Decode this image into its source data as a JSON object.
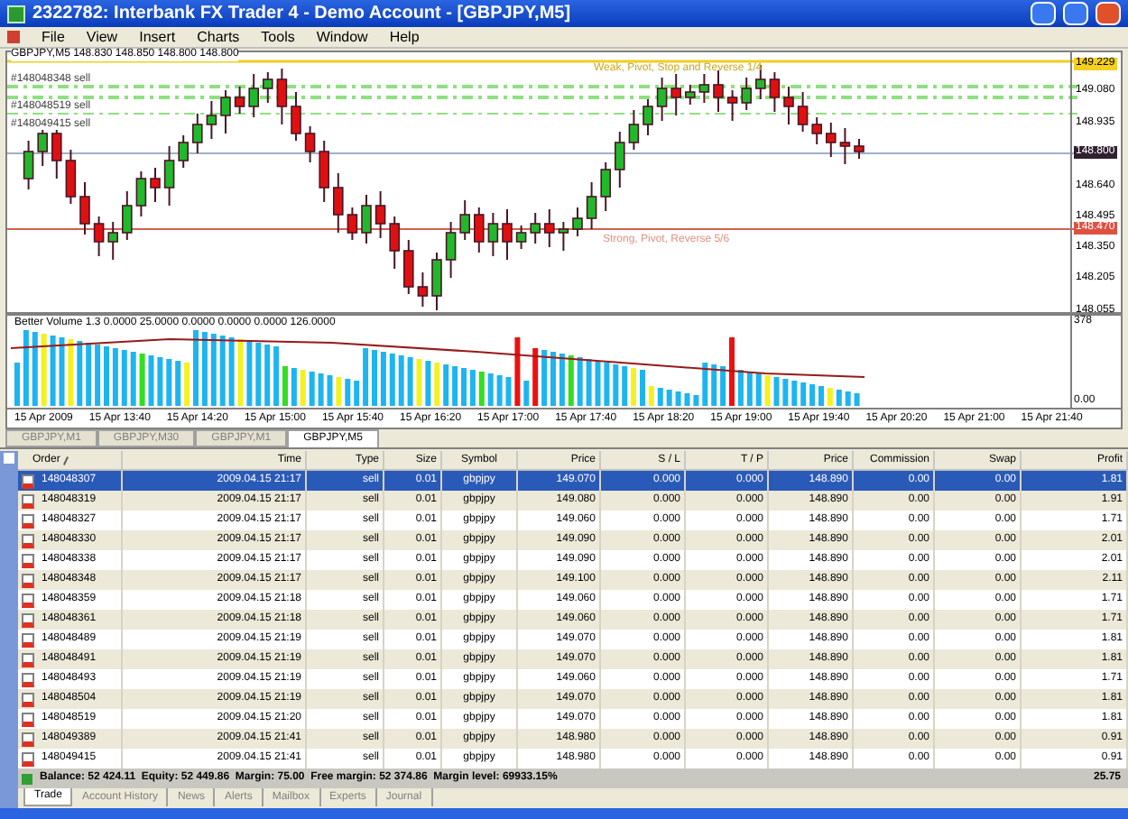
{
  "window": {
    "title": "2322782: Interbank FX Trader 4 - Demo Account - [GBPJPY,M5]"
  },
  "menu": [
    "File",
    "View",
    "Insert",
    "Charts",
    "Tools",
    "Window",
    "Help"
  ],
  "chart": {
    "header": "GBPJPY,M5  148.830 148.850 148.800 148.800",
    "order_labels": [
      "#148048348 sell",
      "#148048519 sell",
      "#148049415 sell"
    ],
    "level_labels": [
      {
        "text": "Weak, Pivot, Stop and Reverse 1/4",
        "kind": "weak"
      },
      {
        "text": "Strong, Pivot, Reverse 5/6",
        "kind": "strong"
      }
    ],
    "price_axis": [
      {
        "text": "149.229",
        "kind": "level"
      },
      {
        "text": "149.080",
        "kind": "plain"
      },
      {
        "text": "148.935",
        "kind": "plain"
      },
      {
        "text": "148.800",
        "kind": "bid"
      },
      {
        "text": "148.640",
        "kind": "plain"
      },
      {
        "text": "148.495",
        "kind": "plain"
      },
      {
        "text": "148.470",
        "kind": "pivot"
      },
      {
        "text": "148.350",
        "kind": "plain"
      },
      {
        "text": "148.205",
        "kind": "plain"
      },
      {
        "text": "148.055",
        "kind": "plain"
      }
    ],
    "volume": {
      "header": "Better Volume 1.3 0.0000 25.0000 0.0000 0.0000 0.0000 126.0000",
      "axis": [
        "378",
        "0.00"
      ]
    },
    "time_axis": [
      "15 Apr 2009",
      "15 Apr 13:40",
      "15 Apr 14:20",
      "15 Apr 15:00",
      "15 Apr 15:40",
      "15 Apr 16:20",
      "15 Apr 17:00",
      "15 Apr 17:40",
      "15 Apr 18:20",
      "15 Apr 19:00",
      "15 Apr 19:40",
      "15 Apr 20:20",
      "15 Apr 21:00",
      "15 Apr 21:40"
    ],
    "tabs": [
      {
        "label": "GBPJPY,M1",
        "selected": false
      },
      {
        "label": "GBPJPY,M30",
        "selected": false
      },
      {
        "label": "GBPJPY,M1",
        "selected": false
      },
      {
        "label": "GBPJPY,M5",
        "selected": true
      }
    ]
  },
  "terminal": {
    "columns": [
      "Order",
      "Time",
      "Type",
      "Size",
      "Symbol",
      "Price",
      "S / L",
      "T / P",
      "Price",
      "Commission",
      "Swap",
      "Profit"
    ],
    "rows": [
      {
        "cells": [
          "148048307",
          "2009.04.15 21:17",
          "sell",
          "0.01",
          "gbpjpy",
          "149.070",
          "0.000",
          "0.000",
          "148.890",
          "0.00",
          "0.00",
          "1.81"
        ],
        "selected": true
      },
      {
        "cells": [
          "148048319",
          "2009.04.15 21:17",
          "sell",
          "0.01",
          "gbpjpy",
          "149.080",
          "0.000",
          "0.000",
          "148.890",
          "0.00",
          "0.00",
          "1.91"
        ],
        "selected": false
      },
      {
        "cells": [
          "148048327",
          "2009.04.15 21:17",
          "sell",
          "0.01",
          "gbpjpy",
          "149.060",
          "0.000",
          "0.000",
          "148.890",
          "0.00",
          "0.00",
          "1.71"
        ],
        "selected": false
      },
      {
        "cells": [
          "148048330",
          "2009.04.15 21:17",
          "sell",
          "0.01",
          "gbpjpy",
          "149.090",
          "0.000",
          "0.000",
          "148.890",
          "0.00",
          "0.00",
          "2.01"
        ],
        "selected": false
      },
      {
        "cells": [
          "148048338",
          "2009.04.15 21:17",
          "sell",
          "0.01",
          "gbpjpy",
          "149.090",
          "0.000",
          "0.000",
          "148.890",
          "0.00",
          "0.00",
          "2.01"
        ],
        "selected": false
      },
      {
        "cells": [
          "148048348",
          "2009.04.15 21:17",
          "sell",
          "0.01",
          "gbpjpy",
          "149.100",
          "0.000",
          "0.000",
          "148.890",
          "0.00",
          "0.00",
          "2.11"
        ],
        "selected": false
      },
      {
        "cells": [
          "148048359",
          "2009.04.15 21:18",
          "sell",
          "0.01",
          "gbpjpy",
          "149.060",
          "0.000",
          "0.000",
          "148.890",
          "0.00",
          "0.00",
          "1.71"
        ],
        "selected": false
      },
      {
        "cells": [
          "148048361",
          "2009.04.15 21:18",
          "sell",
          "0.01",
          "gbpjpy",
          "149.060",
          "0.000",
          "0.000",
          "148.890",
          "0.00",
          "0.00",
          "1.71"
        ],
        "selected": false
      },
      {
        "cells": [
          "148048489",
          "2009.04.15 21:19",
          "sell",
          "0.01",
          "gbpjpy",
          "149.070",
          "0.000",
          "0.000",
          "148.890",
          "0.00",
          "0.00",
          "1.81"
        ],
        "selected": false
      },
      {
        "cells": [
          "148048491",
          "2009.04.15 21:19",
          "sell",
          "0.01",
          "gbpjpy",
          "149.070",
          "0.000",
          "0.000",
          "148.890",
          "0.00",
          "0.00",
          "1.81"
        ],
        "selected": false
      },
      {
        "cells": [
          "148048493",
          "2009.04.15 21:19",
          "sell",
          "0.01",
          "gbpjpy",
          "149.060",
          "0.000",
          "0.000",
          "148.890",
          "0.00",
          "0.00",
          "1.71"
        ],
        "selected": false
      },
      {
        "cells": [
          "148048504",
          "2009.04.15 21:19",
          "sell",
          "0.01",
          "gbpjpy",
          "149.070",
          "0.000",
          "0.000",
          "148.890",
          "0.00",
          "0.00",
          "1.81"
        ],
        "selected": false
      },
      {
        "cells": [
          "148048519",
          "2009.04.15 21:20",
          "sell",
          "0.01",
          "gbpjpy",
          "149.070",
          "0.000",
          "0.000",
          "148.890",
          "0.00",
          "0.00",
          "1.81"
        ],
        "selected": false
      },
      {
        "cells": [
          "148049389",
          "2009.04.15 21:41",
          "sell",
          "0.01",
          "gbpjpy",
          "148.980",
          "0.000",
          "0.000",
          "148.890",
          "0.00",
          "0.00",
          "0.91"
        ],
        "selected": false
      },
      {
        "cells": [
          "148049415",
          "2009.04.15 21:41",
          "sell",
          "0.01",
          "gbpjpy",
          "148.980",
          "0.000",
          "0.000",
          "148.890",
          "0.00",
          "0.00",
          "0.91"
        ],
        "selected": false
      }
    ],
    "summary": {
      "text": "Balance: 52 424.11  Equity: 52 449.86  Margin: 75.00  Free margin: 52 374.86  Margin level: 69933.15%",
      "profit": "25.75"
    },
    "tabs": [
      {
        "label": "Trade",
        "selected": true
      },
      {
        "label": "Account History",
        "selected": false
      },
      {
        "label": "News",
        "selected": false
      },
      {
        "label": "Alerts",
        "selected": false
      },
      {
        "label": "Mailbox",
        "selected": false
      },
      {
        "label": "Experts",
        "selected": false
      },
      {
        "label": "Journal",
        "selected": false
      }
    ]
  }
}
